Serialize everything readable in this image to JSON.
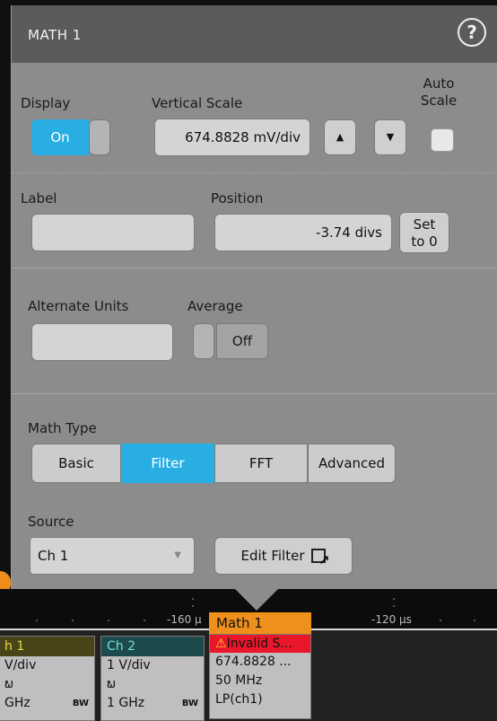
{
  "dialog": {
    "title": "MATH 1",
    "help_icon": "help-icon"
  },
  "display": {
    "label": "Display",
    "toggle_on": "On"
  },
  "vertical_scale": {
    "label": "Vertical Scale",
    "value": "674.8828 mV/div",
    "up": "▲",
    "down": "▼"
  },
  "auto_scale": {
    "label_line1": "Auto",
    "label_line2": "Scale",
    "checked": false
  },
  "label_field": {
    "label": "Label",
    "value": ""
  },
  "position": {
    "label": "Position",
    "value": "-3.74 divs"
  },
  "set_to_zero": {
    "line1": "Set",
    "line2": "to 0"
  },
  "alternate_units": {
    "label": "Alternate Units",
    "value": ""
  },
  "average": {
    "label": "Average",
    "toggle_off": "Off"
  },
  "math_type": {
    "label": "Math Type",
    "options": [
      "Basic",
      "Filter",
      "FFT",
      "Advanced"
    ],
    "selected": "Filter"
  },
  "source": {
    "label": "Source",
    "value": "Ch 1"
  },
  "edit_filter": {
    "label": "Edit Filter"
  },
  "graticule": {
    "left_time": "-160 µ",
    "right_time": "-120 µs"
  },
  "badges": {
    "ch1": {
      "title": "h 1",
      "scale": "V/div",
      "coupling": "ພ",
      "bandwidth": "GHz",
      "bw": "BW"
    },
    "ch2": {
      "title": "Ch 2",
      "scale": "1 V/div",
      "coupling": "ພ",
      "bandwidth": "1 GHz",
      "bw": "BW"
    },
    "math1": {
      "title": "Math 1",
      "status": "Invalid S...",
      "scale": "674.8828 ...",
      "bandwidth": "50 MHz",
      "expression": "LP(ch1)"
    }
  },
  "colors": {
    "accent": "#29aee4",
    "math_orange": "#f0901c",
    "ch1_yellow": "#d8c62a",
    "ch2_teal": "#1ab4b4",
    "error_red": "#e8182a"
  }
}
